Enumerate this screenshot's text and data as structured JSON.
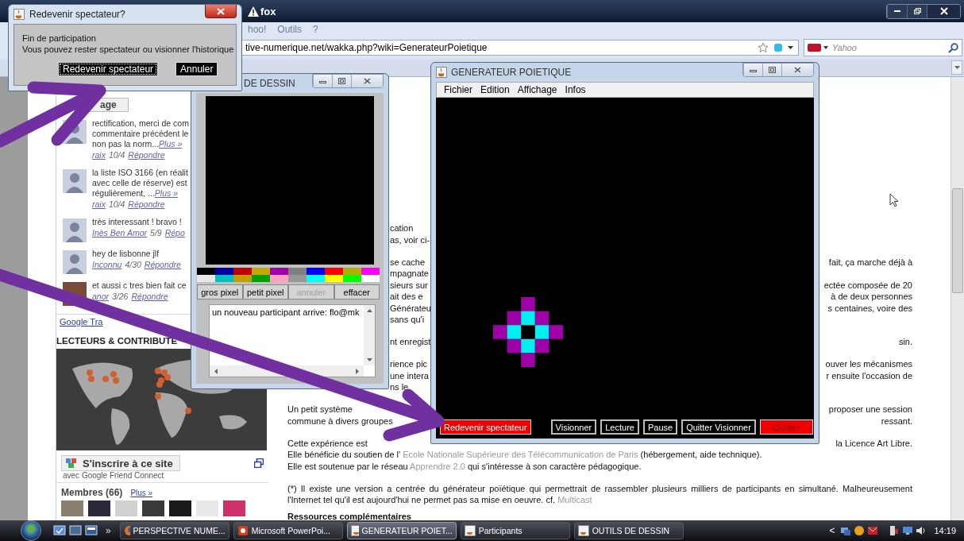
{
  "browser": {
    "title": "fox",
    "menu": [
      "hoo!",
      "Outils",
      "?"
    ],
    "url": "tive-numerique.net/wakka.php?wiki=GenerateurPoietique",
    "search": {
      "placeholder": "Yahoo"
    }
  },
  "sidebar": {
    "page_button": "age",
    "comments": [
      {
        "kind": "silhouette",
        "lines": [
          "rectification, merci de com",
          "commentaire précédent le",
          "non pas la norm..."
        ],
        "more": "Plus »",
        "author": "raix",
        "date": "10/4",
        "reply": "Répondre"
      },
      {
        "kind": "silhouette",
        "lines": [
          "la liste ISO 3166 (en réalit",
          "avec celle de réserve) est",
          "régulièrement, ..."
        ],
        "more": "Plus »",
        "author": "raix",
        "date": "10/4",
        "reply": "Répondre"
      },
      {
        "kind": "silhouette",
        "lines": [
          "très interessant ! bravo !"
        ],
        "author": "Inès Ben Amor",
        "date": "5/9",
        "reply": "Répo"
      },
      {
        "kind": "silhouette",
        "lines": [
          "hey de lisbonne jlf"
        ],
        "author": "Inconnu",
        "date": "4/30",
        "reply": "Répondre"
      },
      {
        "kind": "photo",
        "lines": [
          "et aussi c tres bien fait ce"
        ],
        "author": "anor",
        "date": "3/26",
        "reply": "Répondre"
      }
    ],
    "translate_link": "Google Tra",
    "section_title": "LECTEURS & CONTRIBUTE",
    "join_button": "S'inscrire à ce site",
    "join_caption": "avec Google Friend Connect",
    "members_title": "Membres (66)",
    "members_more": "Plus »"
  },
  "article": [
    {
      "kind": "lines",
      "lines": [
        {
          "middle": "cation"
        },
        {
          "middle": "as, voir ci-"
        }
      ]
    },
    {
      "kind": "lines",
      "lines": [
        {
          "middle": "se cache",
          "right": "fait, ça marche déjà à"
        },
        {
          "middle": "mpagnate"
        },
        {
          "middle": "sieurs sur",
          "right": "ectée composée de 20"
        },
        {
          "middle": "ait des e",
          "right": "à de deux personnes"
        },
        {
          "middle": "Générateu",
          "right": "s centaines, voire des"
        },
        {
          "middle": "sans qu'i"
        }
      ]
    },
    {
      "kind": "lines",
      "lines": [
        {
          "middle": "nt enregist",
          "right": "sin."
        }
      ]
    },
    {
      "kind": "lines",
      "lines": [
        {
          "middle": "rience pic",
          "right": "ouver les mécanismes"
        },
        {
          "middle": "une intera",
          "right": "r ensuite l'occasion de"
        },
        {
          "middle": "ns le"
        }
      ]
    },
    {
      "kind": "lines",
      "lines": [
        {
          "left": "Un petit système",
          "right": "proposer une session"
        },
        {
          "left": "commune à divers groupes",
          "right": "ressant."
        }
      ]
    },
    {
      "kind": "lines",
      "lines": [
        {
          "left": "Cette expérience est",
          "right": "la Licence Art Libre."
        },
        {
          "parts": [
            {
              "kind": "text",
              "text": "Elle bénéficie du soutien de l' "
            },
            {
              "kind": "link",
              "text": "Ecole Nationale Supérieure des Télécommunication de Paris"
            },
            {
              "kind": "text",
              "text": " (hébergement, aide technique)."
            }
          ]
        },
        {
          "parts": [
            {
              "kind": "text",
              "text": "Elle est soutenue par le réseau "
            },
            {
              "kind": "link",
              "text": "Apprendre 2.0"
            },
            {
              "kind": "text",
              "text": " qui s'intéresse à son caractère pédagogique."
            }
          ]
        }
      ]
    },
    {
      "kind": "text",
      "parts": [
        {
          "kind": "text",
          "text": "(*) Il existe une version a centrée du générateur poïétique qui permettrait de rassembler plusieurs milliers de participants en simultané. Malheureusement l'Internet tel qu'il est aujourd'hui ne permet pas sa mise en oeuvre. cf. "
        },
        {
          "kind": "link",
          "text": "Multicast"
        }
      ]
    },
    {
      "kind": "heading",
      "text": "Ressources complémentaires"
    }
  ],
  "dialog": {
    "title": "Redevenir spectateur?",
    "heading": "Fin de participation",
    "message": "Vous pouvez rester spectateur ou visionner l'historique",
    "buttons": [
      {
        "label": "Redevenir spectateur",
        "focused": true
      },
      {
        "label": "Annuler",
        "focused": false
      }
    ]
  },
  "drawing_tools": {
    "title": "DE DESSIN",
    "palette": [
      {
        "color": "#000000"
      },
      {
        "color": "#0000a0"
      },
      {
        "color": "#c00000"
      },
      {
        "color": "#c8a800"
      },
      {
        "color": "#a000a8"
      },
      {
        "color": "#808080"
      },
      {
        "color": "#0000ff"
      },
      {
        "color": "#ff0000"
      },
      {
        "color": "#b0b000"
      },
      {
        "color": "#ff00ff"
      },
      {
        "color": "#e8e8e8"
      },
      {
        "color": "#00c0c0"
      },
      {
        "color": "#c0a000"
      },
      {
        "color": "#00a000"
      },
      {
        "color": "#ffa0c0"
      },
      {
        "color": "#989898"
      },
      {
        "color": "#00ffff"
      },
      {
        "color": "#ffff00"
      },
      {
        "color": "#00ff00"
      },
      {
        "color": "#ffffff"
      }
    ],
    "buttons": [
      {
        "label": "gros pixel",
        "disabled": false
      },
      {
        "label": "petit pixel",
        "disabled": false
      },
      {
        "label": "annuler",
        "disabled": true
      },
      {
        "label": "effacer",
        "disabled": false
      }
    ],
    "log": "un nouveau participant arrive: flo@mk"
  },
  "generator": {
    "title": "GENERATEUR POIETIQUE",
    "menu": [
      "Fichier",
      "Edition",
      "Affichage",
      "Infos"
    ],
    "buttons": [
      {
        "label": "Redevenir spectateur",
        "kind": "alert",
        "disabled": false
      },
      {
        "label": "Visionner",
        "kind": "plain",
        "disabled": false
      },
      {
        "label": "Lecture",
        "kind": "plain",
        "disabled": false
      },
      {
        "label": "Pause",
        "kind": "plain",
        "disabled": false
      },
      {
        "label": "Quitter Visionner",
        "kind": "plain",
        "disabled": false
      },
      {
        "label": "Quitter",
        "kind": "alert",
        "disabled": true
      }
    ]
  },
  "taskbar": {
    "overflow": "»",
    "tasks": [
      {
        "label": "PERSPECTIVE NUME...",
        "selected": false
      },
      {
        "label": "Microsoft PowerPoi...",
        "selected": false
      },
      {
        "label": "GENERATEUR POIET...",
        "selected": true
      },
      {
        "label": "Participants",
        "selected": false
      },
      {
        "label": "OUTILS DE DESSIN",
        "selected": false
      }
    ],
    "tray_toggle": "<",
    "clock": "14:19"
  }
}
